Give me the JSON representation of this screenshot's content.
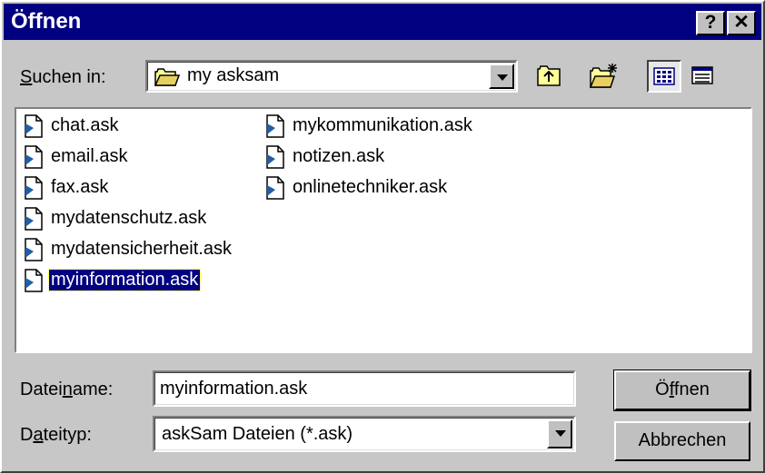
{
  "window": {
    "title": "Öffnen",
    "help_label": "?",
    "close_label": "✕"
  },
  "look_in": {
    "label_u": "S",
    "label_rest": "uchen in:",
    "value": "my asksam"
  },
  "toolbar": {
    "icons": [
      "up-folder-icon",
      "new-folder-icon",
      "list-view-icon",
      "details-view-icon"
    ]
  },
  "files": [
    {
      "name": "chat.ask"
    },
    {
      "name": "email.ask"
    },
    {
      "name": "fax.ask"
    },
    {
      "name": "mydatenschutz.ask"
    },
    {
      "name": "mydatensicherheit.ask"
    },
    {
      "name": "myinformation.ask",
      "selected": true
    },
    {
      "name": "mykommunikation.ask"
    },
    {
      "name": "notizen.ask"
    },
    {
      "name": "onlinetechniker.ask"
    }
  ],
  "filename": {
    "label_pre": "Datei",
    "label_u": "n",
    "label_post": "ame:",
    "value": "myinformation.ask"
  },
  "filetype": {
    "label_pre": "D",
    "label_u": "a",
    "label_post": "teityp:",
    "value": "askSam Dateien (*.ask)"
  },
  "buttons": {
    "open_pre": "Ö",
    "open_u": "f",
    "open_post": "fnen",
    "cancel": "Abbrechen"
  },
  "colors": {
    "titlebar": "#000080",
    "face": "#c7c7c7",
    "selection": "#000080"
  }
}
